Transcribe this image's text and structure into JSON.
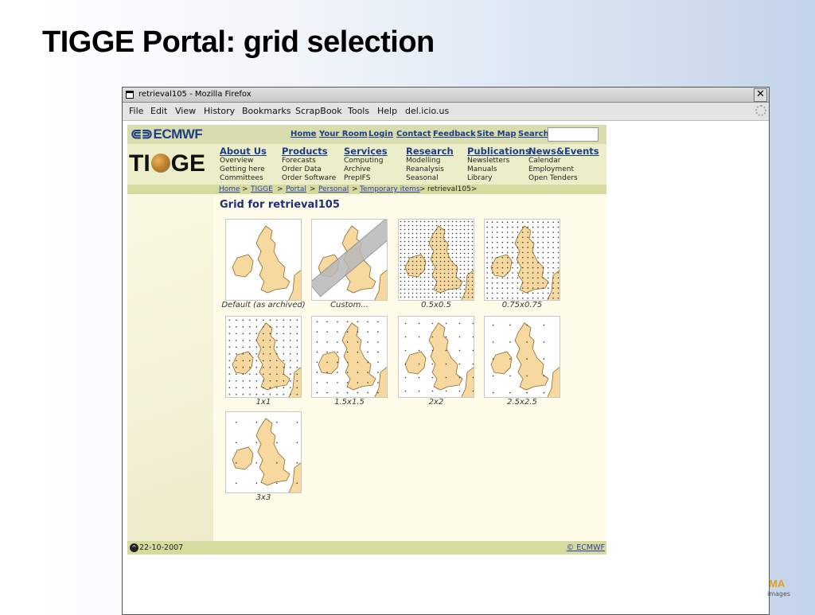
{
  "slide": {
    "title": "TIGGE Portal: grid selection"
  },
  "window": {
    "title": "retrieval105 - Mozilla Firefox",
    "close_label": "✕",
    "menus": [
      "File",
      "Edit",
      "View",
      "History",
      "Bookmarks",
      "ScrapBook",
      "Tools",
      "Help",
      "del.icio.us"
    ]
  },
  "site": {
    "brand": "ECMWF",
    "brand_symbol": "⋐⋑",
    "top_links": [
      "Home",
      "Your Room",
      "Login",
      "Contact",
      "Feedback",
      "Site Map",
      "Search"
    ],
    "logo": {
      "t": "TI",
      "rest": "GE"
    },
    "nav": [
      {
        "head": "About Us",
        "items": [
          "Overview",
          "Getting here",
          "Committees"
        ]
      },
      {
        "head": "Products",
        "items": [
          "Forecasts",
          "Order Data",
          "Order Software"
        ]
      },
      {
        "head": "Services",
        "items": [
          "Computing",
          "Archive",
          "PrepIFS"
        ]
      },
      {
        "head": "Research",
        "items": [
          "Modelling",
          "Reanalysis",
          "Seasonal"
        ]
      },
      {
        "head": "Publications",
        "items": [
          "Newsletters",
          "Manuals",
          "Library"
        ]
      },
      {
        "head": "News&Events",
        "items": [
          "Calendar",
          "Employment",
          "Open Tenders"
        ]
      }
    ],
    "breadcrumb": {
      "links": [
        "Home",
        "TIGGE",
        "Portal",
        "Personal",
        "Temporary items"
      ],
      "separator": ">",
      "current": "retrieval105>"
    },
    "heading": "Grid for retrieval105",
    "grids": [
      {
        "label": "Default (as archived)",
        "dot_spacing_deg": 0
      },
      {
        "label": "Custom...",
        "dot_spacing_deg": 0
      },
      {
        "label": "0.5x0.5",
        "dot_spacing_deg": 0.5
      },
      {
        "label": "0.75x0.75",
        "dot_spacing_deg": 0.75
      },
      {
        "label": "1x1",
        "dot_spacing_deg": 1
      },
      {
        "label": "1.5x1.5",
        "dot_spacing_deg": 1.5
      },
      {
        "label": "2x2",
        "dot_spacing_deg": 2
      },
      {
        "label": "2.5x2.5",
        "dot_spacing_deg": 2.5
      },
      {
        "label": "3x3",
        "dot_spacing_deg": 3
      }
    ],
    "footer": {
      "date": "22-10-2007",
      "copyright": "© ECMWF",
      "up_icon": "^"
    }
  },
  "corner": {
    "logo": "MA",
    "sub": "images"
  },
  "colors": {
    "land": "#f7d9a0",
    "coast": "#8a6a2a",
    "link": "#1d3d86",
    "grid_dot": "#333333"
  }
}
